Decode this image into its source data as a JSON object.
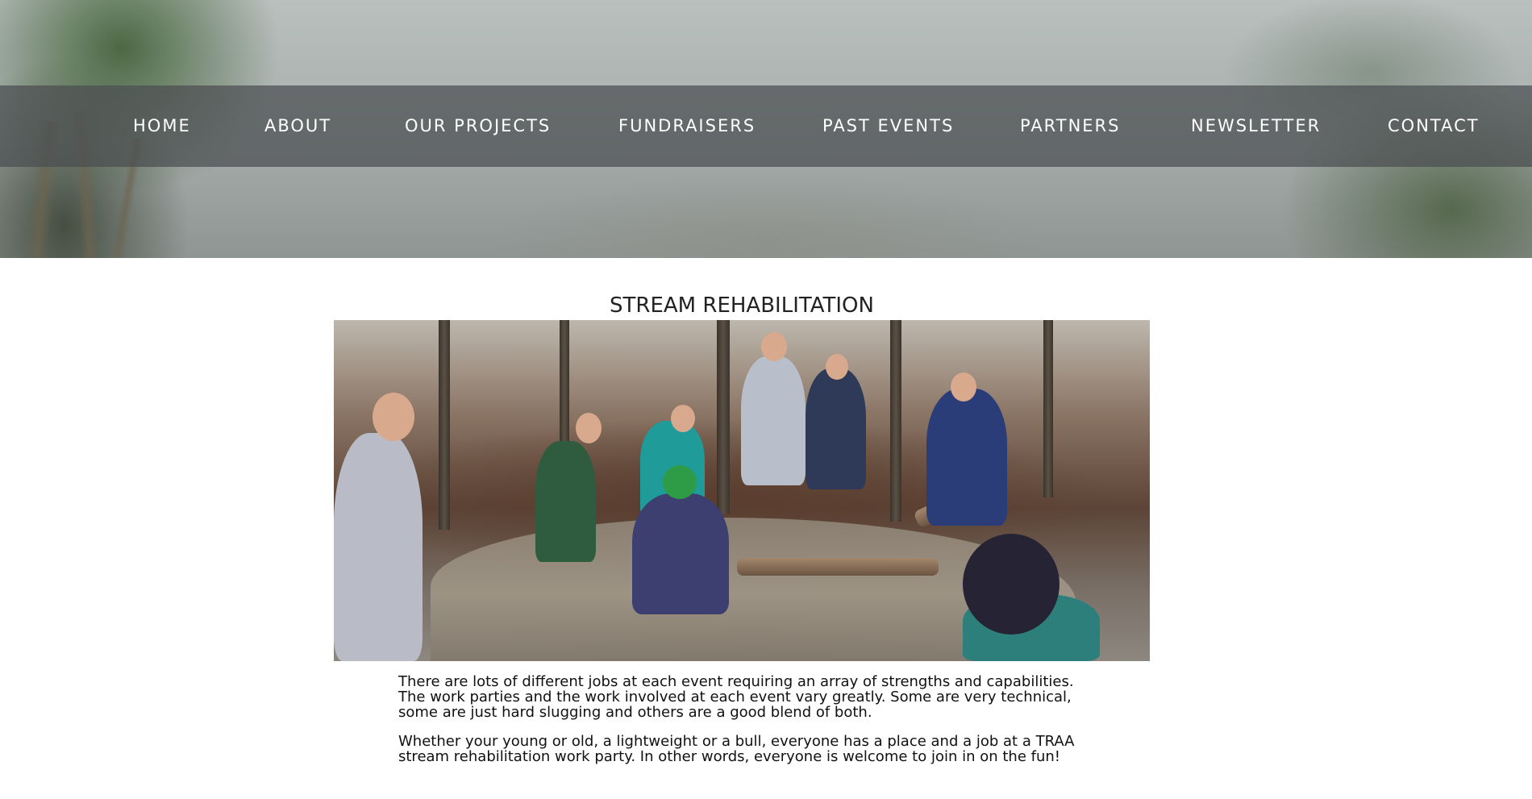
{
  "nav": {
    "items": [
      {
        "label": "HOME"
      },
      {
        "label": "ABOUT"
      },
      {
        "label": "OUR PROJECTS"
      },
      {
        "label": "FUNDRAISERS"
      },
      {
        "label": "PAST EVENTS"
      },
      {
        "label": "PARTNERS"
      },
      {
        "label": "NEWSLETTER"
      },
      {
        "label": "CONTACT"
      }
    ]
  },
  "content": {
    "title": "STREAM REHABILITATION",
    "paragraphs": [
      "There are lots of different jobs at each event requiring an array of strengths and capabilities. The work parties and the work involved at each event vary greatly. Some are very technical, some are just hard slugging and others are a good blend of both.",
      "Whether your young or old, a lightweight or a bull, everyone has a place and a job at a TRAA stream rehabilitation work party. In other words, everyone is welcome to join in on the fun!"
    ]
  },
  "colors": {
    "nav_background": "#4b4e50",
    "nav_text": "#ffffff",
    "body_text": "#111111",
    "page_background": "#ffffff"
  }
}
